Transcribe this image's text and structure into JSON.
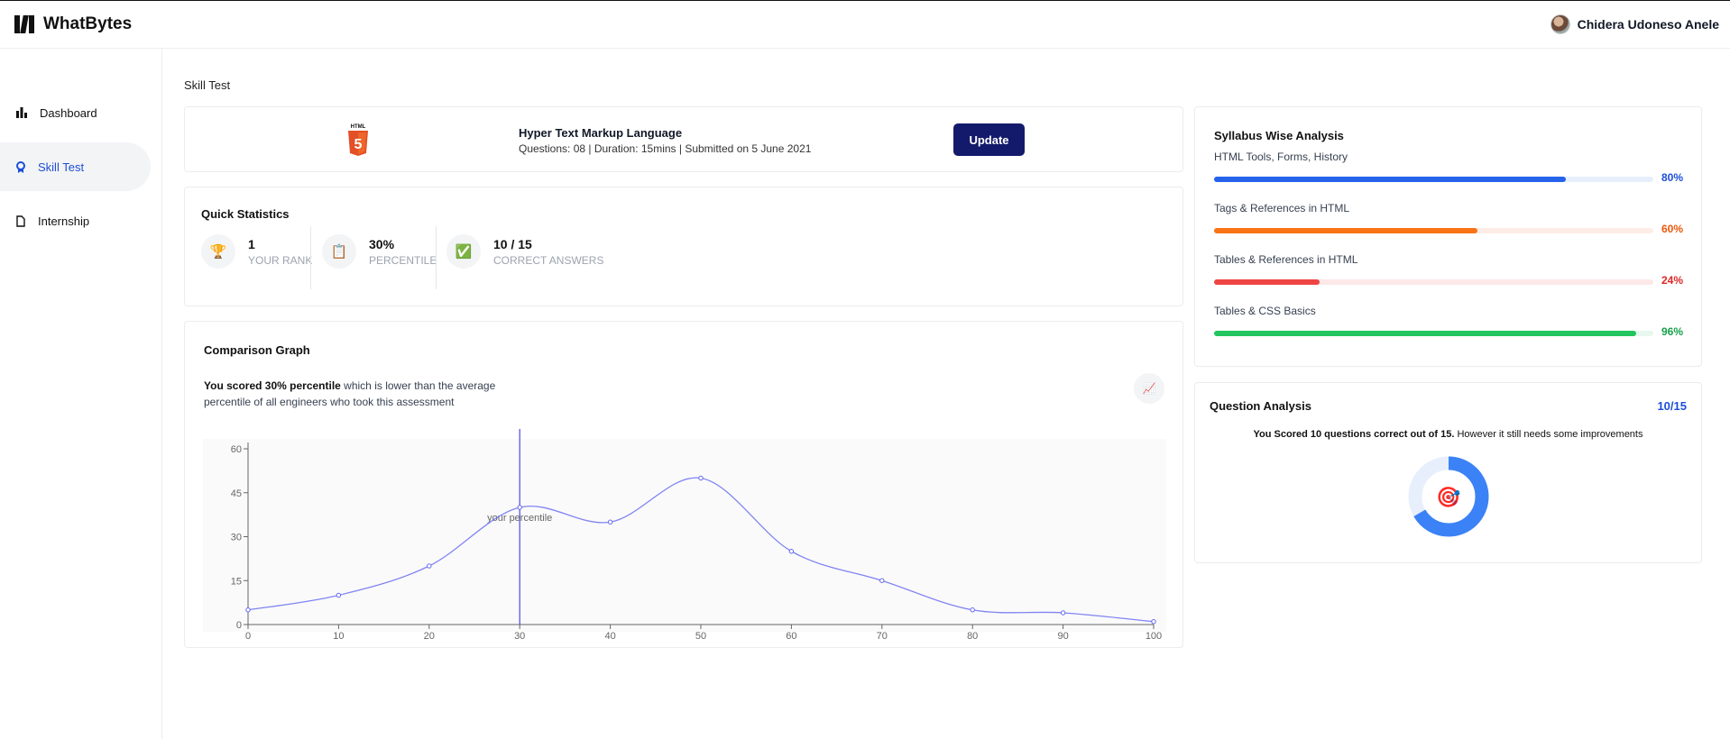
{
  "header": {
    "brand": "WhatBytes",
    "user_name": "Chidera Udoneso Anele"
  },
  "sidebar": {
    "items": [
      {
        "label": "Dashboard",
        "icon": "bar-chart-icon"
      },
      {
        "label": "Skill Test",
        "icon": "badge-icon",
        "active": true
      },
      {
        "label": "Internship",
        "icon": "document-icon"
      }
    ]
  },
  "breadcrumb": "Skill Test",
  "test": {
    "logo_text": "HTML",
    "logo_number": "5",
    "title": "Hyper Text Markup Language",
    "meta": "Questions: 08 | Duration: 15mins | Submitted on 5 June 2021",
    "update_label": "Update"
  },
  "quick_stats": {
    "title": "Quick Statistics",
    "items": [
      {
        "value": "1",
        "label": "YOUR RANK",
        "icon": "trophy-icon",
        "glyph": "🏆"
      },
      {
        "value": "30%",
        "label": "PERCENTILE",
        "icon": "clipboard-icon",
        "glyph": "📋"
      },
      {
        "value": "10 / 15",
        "label": "CORRECT ANSWERS",
        "icon": "check-icon",
        "glyph": "✅"
      }
    ]
  },
  "comparison": {
    "title": "Comparison Graph",
    "desc_bold": "You scored 30% percentile",
    "desc_rest": " which is lower than the average percentile of all engineers who took this assessment",
    "icon_glyph": "📈",
    "marker_label": "your percentile"
  },
  "chart_data": {
    "type": "line",
    "x": [
      0,
      10,
      20,
      30,
      40,
      50,
      60,
      70,
      80,
      90,
      100
    ],
    "series": [
      {
        "values": [
          5,
          10,
          20,
          40,
          35,
          50,
          25,
          15,
          5,
          4,
          1
        ]
      }
    ],
    "x_ticks": [
      "0",
      "10",
      "20",
      "30",
      "40",
      "50",
      "60",
      "70",
      "80",
      "90",
      "100"
    ],
    "y_ticks": [
      "0",
      "15",
      "30",
      "45",
      "60"
    ],
    "xlim": [
      0,
      100
    ],
    "ylim": [
      0,
      60
    ],
    "marker_x": 30,
    "marker_label": "your percentile",
    "line_color": "#6366f1"
  },
  "syllabus": {
    "title": "Syllabus Wise Analysis",
    "items": [
      {
        "label": "HTML Tools, Forms, History",
        "pct": "80%",
        "value": 0.8,
        "color": "#2563eb",
        "track": "#e8effc",
        "text_color": "#1d4ed8"
      },
      {
        "label": "Tags & References in HTML",
        "pct": "60%",
        "value": 0.6,
        "color": "#f97316",
        "track": "#fdede6",
        "text_color": "#ea580c"
      },
      {
        "label": "Tables & References in HTML",
        "pct": "24%",
        "value": 0.24,
        "color": "#ef4444",
        "track": "#fde8e8",
        "text_color": "#dc2626"
      },
      {
        "label": "Tables & CSS Basics",
        "pct": "96%",
        "value": 0.96,
        "color": "#22c55e",
        "track": "#e7f8ee",
        "text_color": "#16a34a"
      }
    ]
  },
  "question_analysis": {
    "title": "Question Analysis",
    "score": "10/15",
    "text_bold": "You Scored 10 questions correct out of 15.",
    "text_rest": " However it still needs some improvements",
    "fraction": 0.6667,
    "center_glyph": "🎯"
  }
}
